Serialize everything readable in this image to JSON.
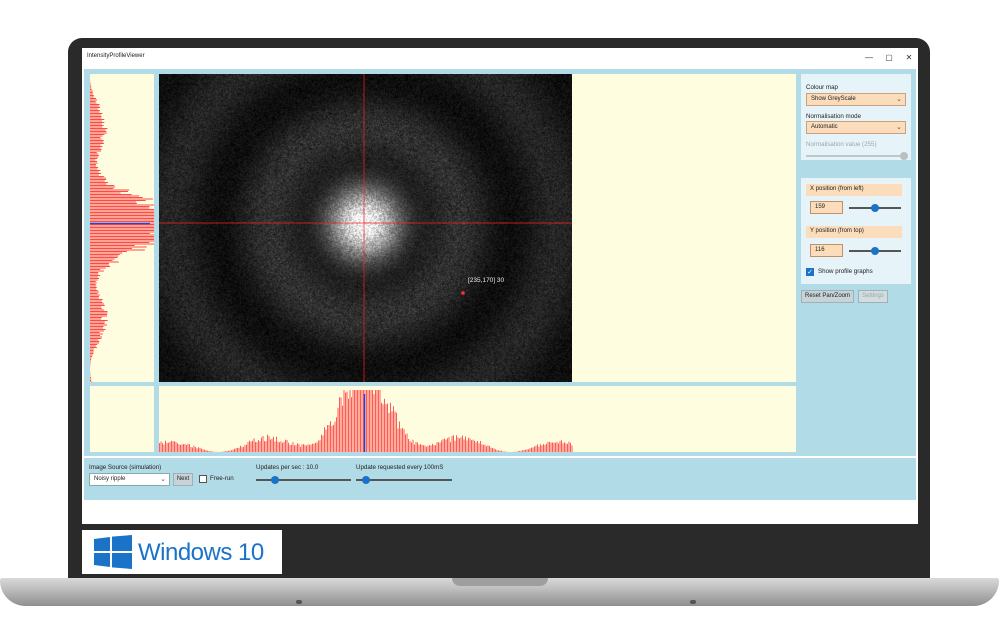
{
  "window": {
    "title": "IntensityProfileViewer",
    "minimize": "—",
    "maximize": "▢",
    "close": "✕"
  },
  "image": {
    "marker_label": "[235,170] 30"
  },
  "side": {
    "colour_map_label": "Colour map",
    "colour_map_value": "Show GreyScale",
    "norm_mode_label": "Normalisation mode",
    "norm_mode_value": "Automatic",
    "norm_value_label": "Normalisation value (255)",
    "norm_value_slider": 1.0,
    "x_label": "X position (from left)",
    "x_value": "159",
    "x_slider": 0.5,
    "y_label": "Y position (from top)",
    "y_value": "116",
    "y_slider": 0.5,
    "show_profile_label": "Show profile graphs",
    "reset_label": "Reset Pan/Zoom",
    "settings_label": "Settings"
  },
  "bottom": {
    "source_label": "Image Source (simulation)",
    "source_value": "Noisy ripple",
    "next_label": "Next",
    "freerun_label": "Free-run",
    "ups_label": "Updates per sec : 10.0",
    "ups_slider": 0.2,
    "req_label": "Update requested every 100mS",
    "req_slider": 0.1
  },
  "branding": {
    "os_label": "Windows 10"
  },
  "colors": {
    "panel": "#b1dbe6",
    "cream": "#fffde0",
    "accent": "#1a73c7",
    "profile": "#ff4a4a",
    "crosshair": "#ff2020"
  }
}
